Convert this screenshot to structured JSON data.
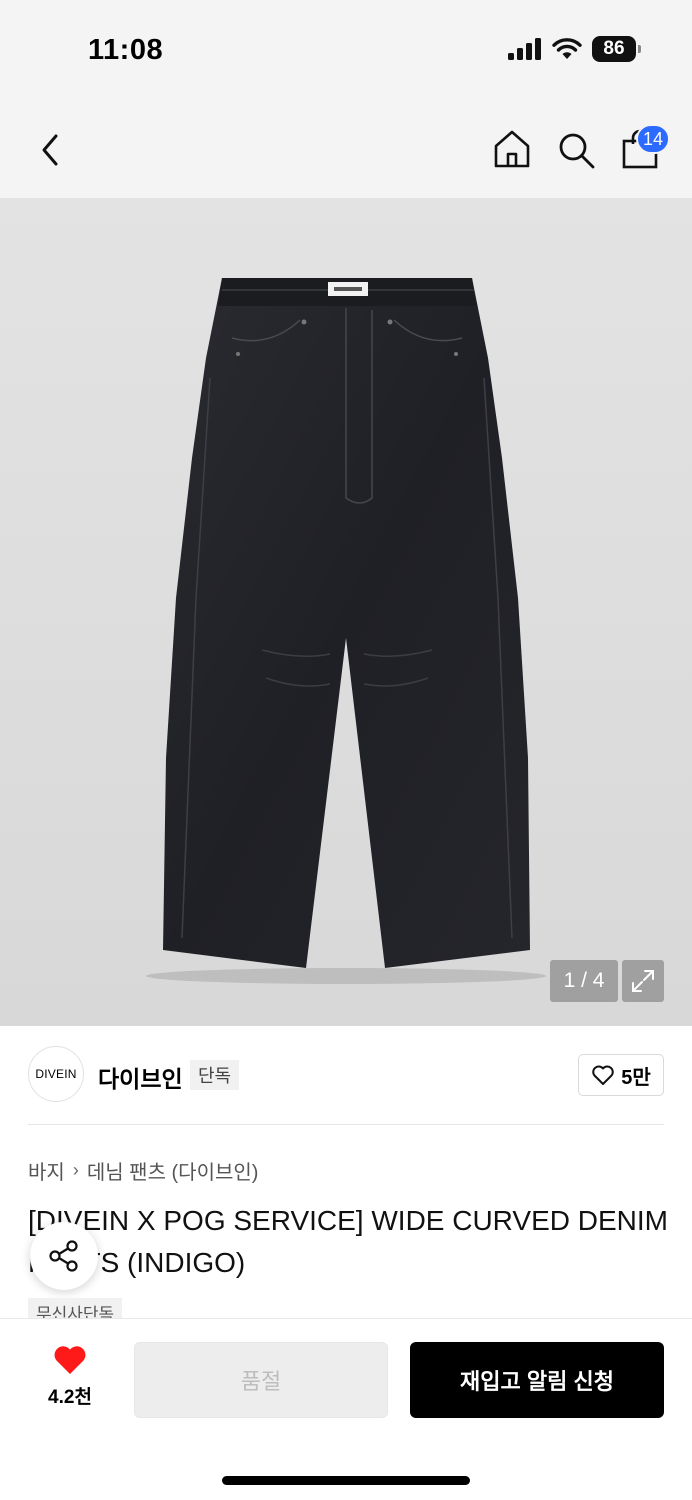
{
  "status_bar": {
    "time": "11:08",
    "battery": "86",
    "icons": [
      "cellular-signal-icon",
      "wifi-icon",
      "battery-icon"
    ]
  },
  "nav": {
    "icons": [
      "chevron-left-icon",
      "home-icon",
      "search-icon",
      "shopping-bag-icon"
    ],
    "cart_count": "14"
  },
  "gallery": {
    "counter": "1 / 4",
    "image_subject": "dark indigo wide curved denim pants"
  },
  "brand": {
    "logo_text": "DIVEIN",
    "name": "다이브인",
    "exclusive_tag": "단독",
    "likes": "5만"
  },
  "breadcrumb": {
    "category": "바지",
    "subcategory": "데님 팬츠 (다이브인)"
  },
  "product": {
    "title": "[DIVEIN X POG SERVICE] WIDE CURVED DENIM PANTS (INDIGO)",
    "tag": "무신사단독"
  },
  "bottom_bar": {
    "heart_count": "4.2천",
    "soldout_label": "품절",
    "restock_label": "재입고 알림 신청"
  },
  "colors": {
    "accent_red": "#ff1a1a",
    "badge_blue": "#2b6bff",
    "primary_button": "#000000"
  }
}
